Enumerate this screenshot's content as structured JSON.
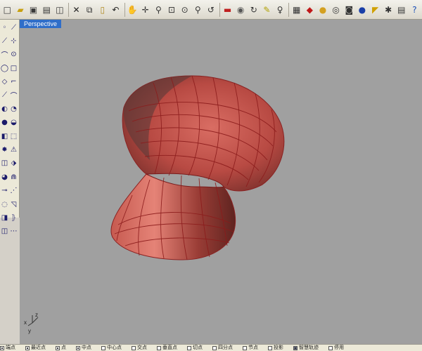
{
  "toolbar": {
    "icons": [
      {
        "name": "new-file-icon",
        "glyph": "□",
        "color": "#333333"
      },
      {
        "name": "open-folder-icon",
        "glyph": "▰",
        "color": "#c8a010"
      },
      {
        "name": "save-icon",
        "glyph": "▣",
        "color": "#3a3a3a"
      },
      {
        "name": "print-icon",
        "glyph": "▤",
        "color": "#333333"
      },
      {
        "name": "import-icon",
        "glyph": "◫",
        "color": "#333333"
      },
      {
        "name": "cut-icon",
        "glyph": "✕",
        "color": "#222222"
      },
      {
        "name": "copy-icon",
        "glyph": "⧉",
        "color": "#333333"
      },
      {
        "name": "paste-icon",
        "glyph": "▯",
        "color": "#b08a20"
      },
      {
        "name": "undo-icon",
        "glyph": "↶",
        "color": "#222222"
      },
      {
        "name": "pan-icon",
        "glyph": "✋",
        "color": "#333333"
      },
      {
        "name": "rotate-view-icon",
        "glyph": "✛",
        "color": "#333333"
      },
      {
        "name": "zoom-icon",
        "glyph": "⚲",
        "color": "#333333"
      },
      {
        "name": "zoom-window-icon",
        "glyph": "⊡",
        "color": "#333333"
      },
      {
        "name": "zoom-extents-icon",
        "glyph": "⊙",
        "color": "#333333"
      },
      {
        "name": "zoom-selected-icon",
        "glyph": "⚲",
        "color": "#333333"
      },
      {
        "name": "undo-view-icon",
        "glyph": "↺",
        "color": "#333333"
      },
      {
        "name": "car-icon",
        "glyph": "▬",
        "color": "#c02020"
      },
      {
        "name": "eye-icon",
        "glyph": "◉",
        "color": "#555555"
      },
      {
        "name": "refresh-icon",
        "glyph": "↻",
        "color": "#333333"
      },
      {
        "name": "layer-icon",
        "glyph": "✎",
        "color": "#b0a000"
      },
      {
        "name": "light-bulb-icon",
        "glyph": "♀",
        "color": "#333333"
      },
      {
        "name": "properties-icon",
        "glyph": "▦",
        "color": "#333333"
      },
      {
        "name": "color-icon",
        "glyph": "◆",
        "color": "#c01818"
      },
      {
        "name": "color-wheel-icon",
        "glyph": "●",
        "color": "#d4a020"
      },
      {
        "name": "shade-icon",
        "glyph": "◎",
        "color": "#333333"
      },
      {
        "name": "render-icon",
        "glyph": "◙",
        "color": "#333333"
      },
      {
        "name": "sphere-icon",
        "glyph": "●",
        "color": "#1a3fa8"
      },
      {
        "name": "flag-icon",
        "glyph": "◤",
        "color": "#d0a000"
      },
      {
        "name": "settings-icon",
        "glyph": "✱",
        "color": "#333333"
      },
      {
        "name": "options-icon",
        "glyph": "▤",
        "color": "#333333"
      },
      {
        "name": "help-icon",
        "glyph": "?",
        "color": "#1a4fb8"
      }
    ]
  },
  "left_toolbar": {
    "rows": [
      [
        "◦",
        "⟋"
      ],
      [
        "⟋",
        "⊹"
      ],
      [
        "⌒",
        "⊙"
      ],
      [
        "◯",
        "□"
      ],
      [
        "◇",
        "⌐"
      ],
      [
        "⟋",
        "⌒"
      ],
      [
        "◐",
        "◔"
      ],
      [
        "●",
        "◒"
      ],
      [
        "◧",
        "⬚"
      ],
      [
        "✸",
        "⚠"
      ],
      [
        "◫",
        "⬗"
      ],
      [
        "◕",
        "⋒"
      ],
      [
        "⊸",
        "⋰"
      ],
      [
        "◌",
        "◹"
      ],
      [
        "◨",
        "⦄"
      ],
      [
        "◫",
        "⋯"
      ]
    ]
  },
  "viewport": {
    "title": "Perspective",
    "background": "#a0a0a0",
    "axis": {
      "x": "x",
      "y": "y",
      "z": "z"
    }
  },
  "osnap": {
    "items": [
      {
        "label": "端点",
        "checked": true
      },
      {
        "label": "最近点",
        "checked": true
      },
      {
        "label": "点",
        "checked": true
      },
      {
        "label": "中点",
        "checked": true
      },
      {
        "label": "中心点",
        "checked": false
      },
      {
        "label": "交点",
        "checked": false
      },
      {
        "label": "垂直点",
        "checked": false
      },
      {
        "label": "切点",
        "checked": false
      },
      {
        "label": "四分点",
        "checked": false
      },
      {
        "label": "节点",
        "checked": false
      },
      {
        "label": "投影",
        "checked": false
      },
      {
        "label": "智慧轨迹",
        "checked": true
      },
      {
        "label": "停用",
        "checked": false
      }
    ]
  }
}
